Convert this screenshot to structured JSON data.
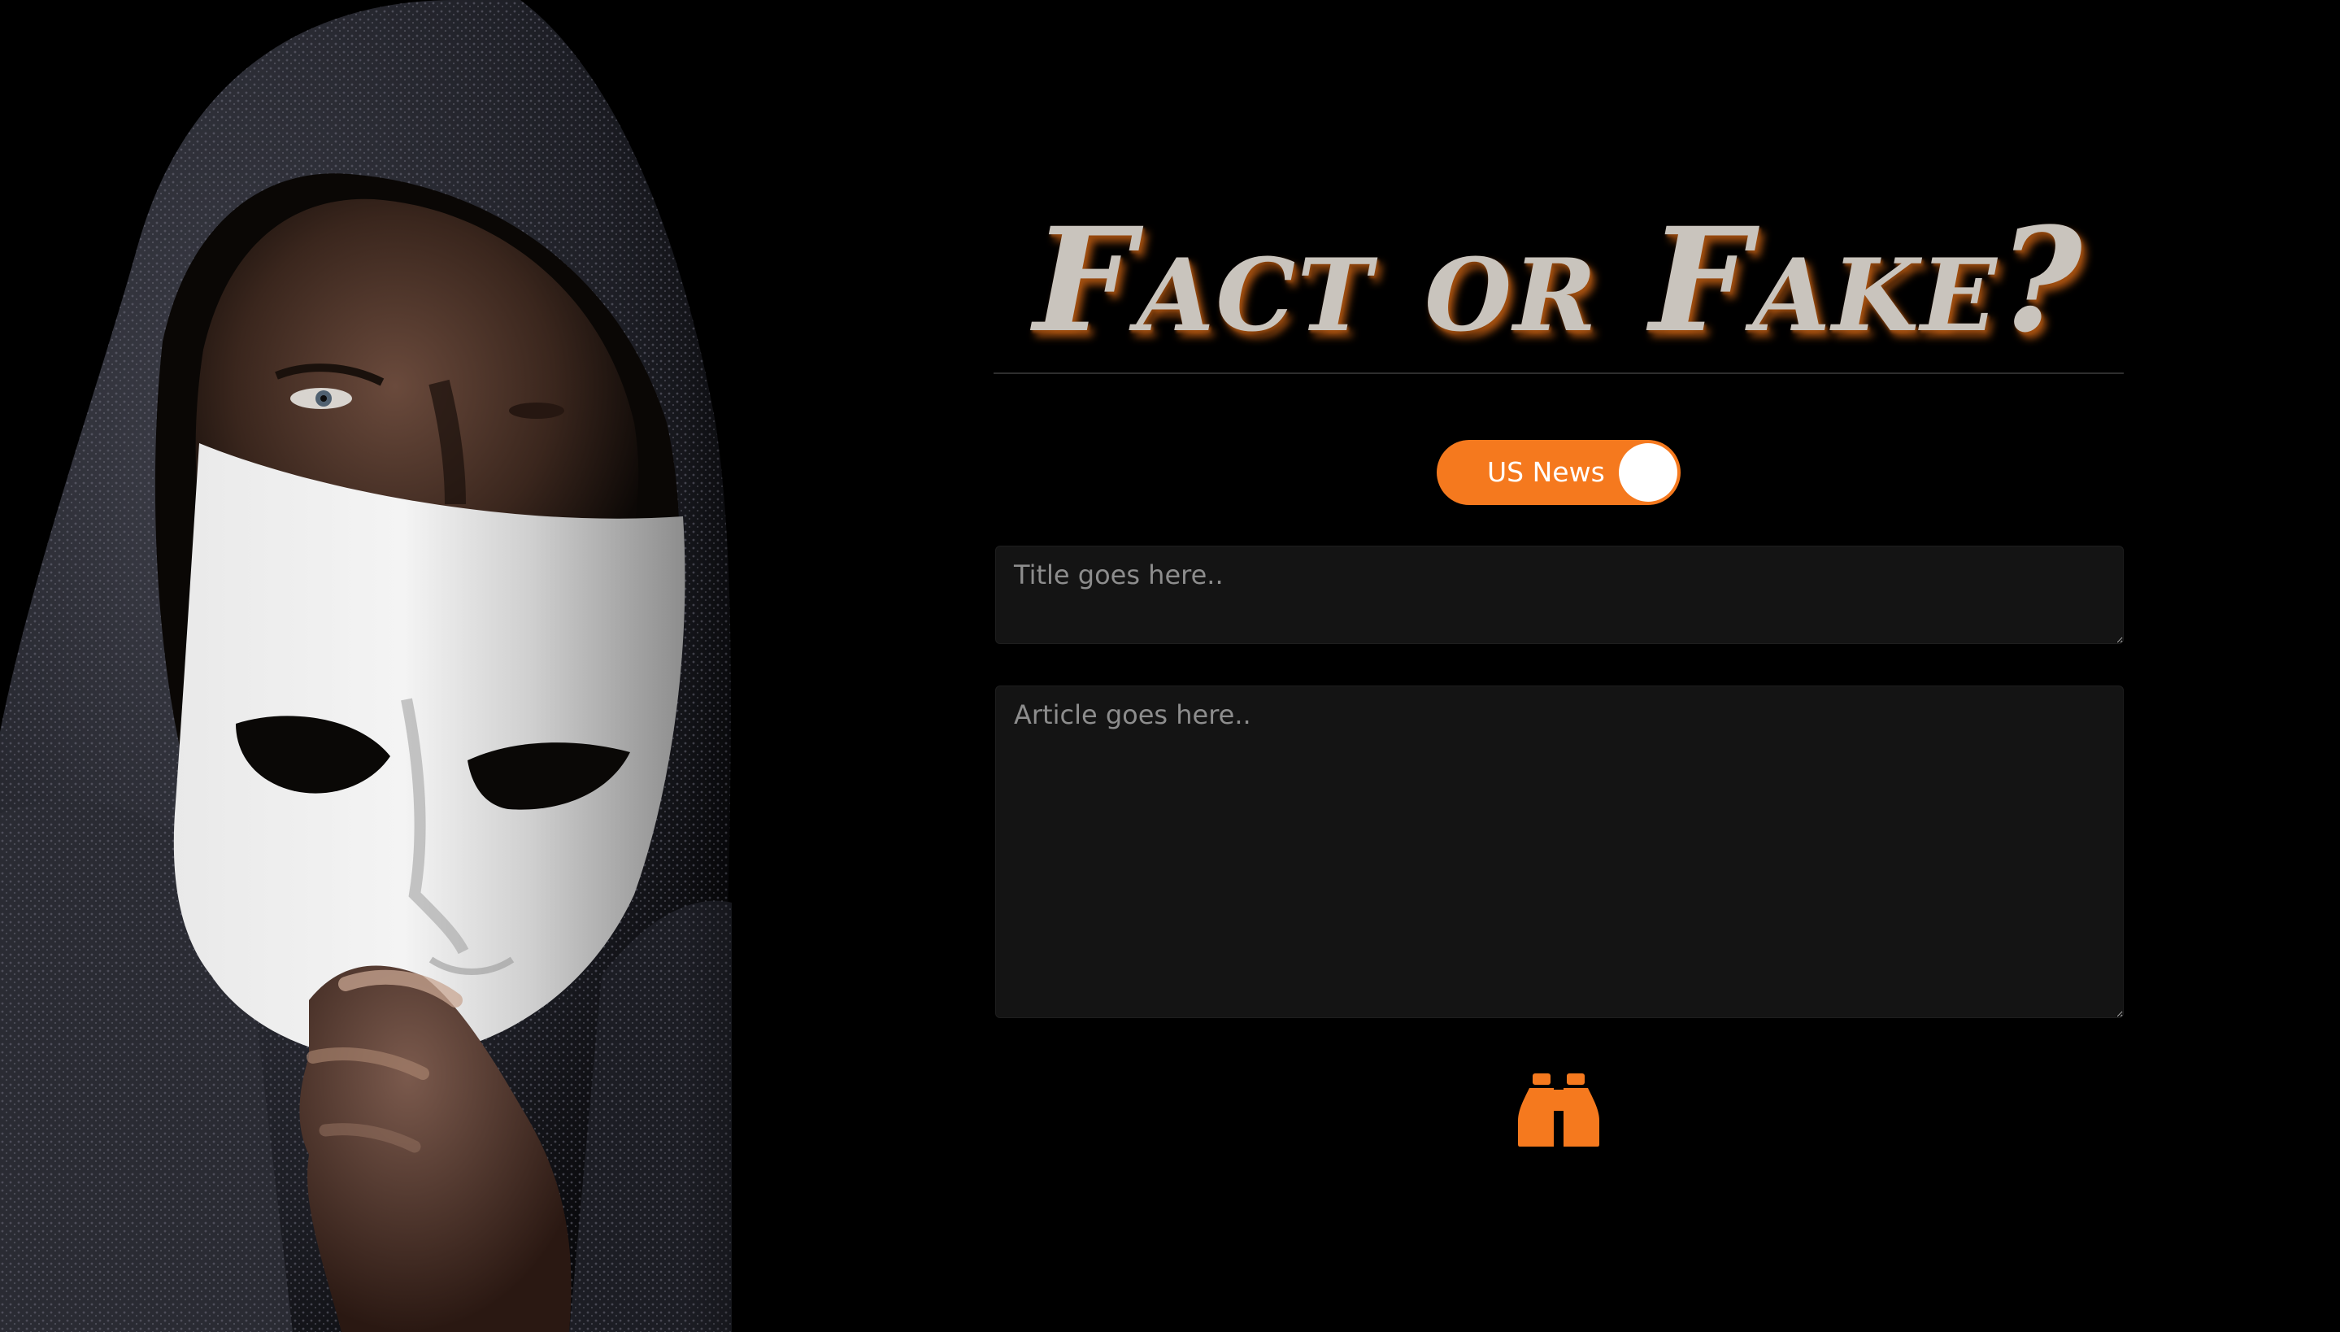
{
  "hero": {
    "icon": "hooded-person-holding-mask-photo"
  },
  "header": {
    "title": "Fact or Fake?"
  },
  "toggle": {
    "label": "US News",
    "state": "on",
    "color": "#f5791e"
  },
  "form": {
    "title_placeholder": "Title goes here..",
    "article_placeholder": "Article goes here..",
    "title_value": "",
    "article_value": ""
  },
  "submit": {
    "icon": "binoculars-icon",
    "color": "#f5791e"
  },
  "colors": {
    "background": "#000000",
    "accent": "#f5791e",
    "input_bg": "#141414",
    "title_text": "#c9c4bd"
  }
}
